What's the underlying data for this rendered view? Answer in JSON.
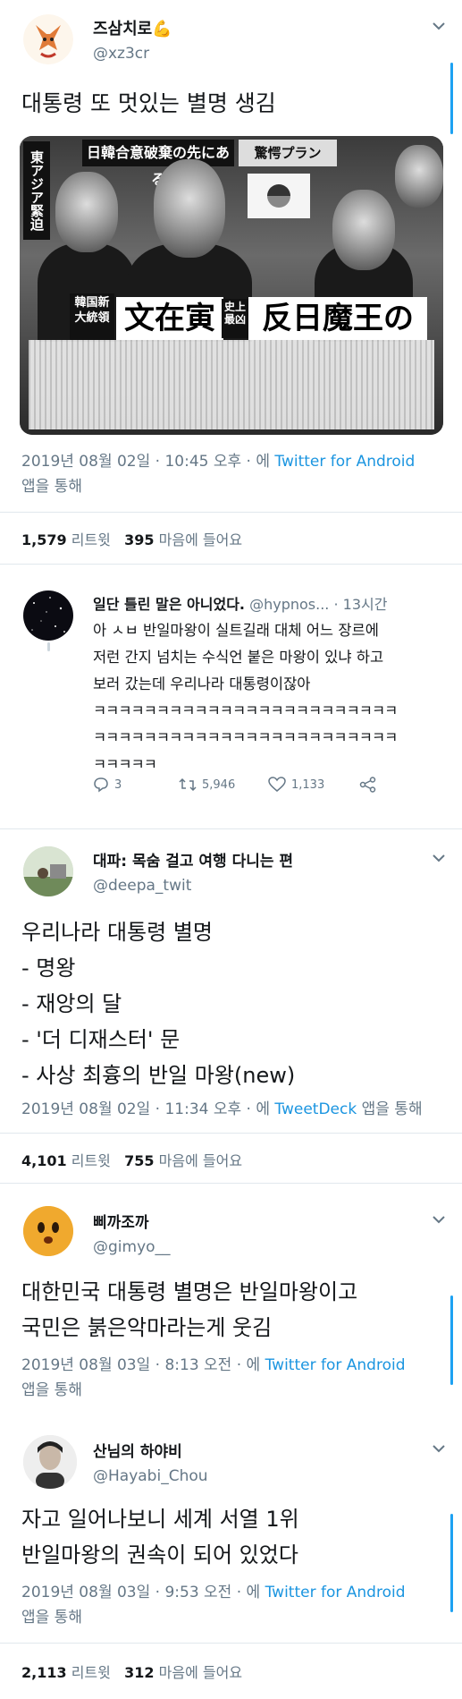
{
  "tweet1": {
    "name": "즈삼치로💪",
    "handle": "@xz3cr",
    "text": "대통령 또 멋있는 별명 생김",
    "photo": {
      "banner": "日韓合意破棄の先にある",
      "banner2": "驚愕プラン",
      "side": "東アジア緊迫",
      "korea_label": "韓国新大統領",
      "name_label": "文在寅",
      "hist_label": "史上最凶",
      "evil_label": "反日魔王の"
    },
    "meta_date": "2019년 08월 02일 · 10:45 오후 · 에 ",
    "meta_source": "Twitter for Android",
    "meta_suffix": "앱을 통해",
    "retweets": "1,579",
    "retweets_label": "리트윗",
    "likes": "395",
    "likes_label": "마음에 들어요"
  },
  "reply": {
    "name": "일단 틀린 말은 아니었다.",
    "handle": "@hypnos...",
    "time": "· 13시간",
    "lines": [
      "아 ㅅㅂ 반일마왕이 실트길래 대체 어느 장르에",
      "저런 간지 넘치는 수식언 붙은 마왕이 있냐 하고",
      "보러 갔는데 우리나라 대통령이잖아",
      "ㅋㅋㅋㅋㅋㅋㅋㅋㅋㅋㅋㅋㅋㅋㅋㅋㅋㅋㅋㅋㅋㅋㅋㅋ",
      "ㅋㅋㅋㅋㅋㅋㅋㅋㅋㅋㅋㅋㅋㅋㅋㅋㅋㅋㅋㅋㅋㅋㅋㅋ",
      "ㅋㅋㅋㅋㅋ"
    ],
    "replies": "3",
    "retweets": "5,946",
    "likes": "1,133"
  },
  "tweet2": {
    "name": "대파: 목숨 걸고 여행 다니는 편",
    "handle": "@deepa_twit",
    "lines": [
      "우리나라 대통령 별명",
      "- 명왕",
      "- 재앙의 달",
      "- '더 디재스터' 문",
      "- 사상 최흉의 반일 마왕(new)"
    ],
    "meta_date": "2019년 08월 02일 · 11:34 오후 · 에 ",
    "meta_source": "TweetDeck",
    "meta_suffix": " 앱을 통해",
    "retweets": "4,101",
    "retweets_label": "리트윗",
    "likes": "755",
    "likes_label": "마음에 들어요"
  },
  "tweet3": {
    "name": "삐까조까",
    "handle": "@gimyo__",
    "lines": [
      "대한민국 대통령 별명은 반일마왕이고",
      "국민은 붉은악마라는게 웃김"
    ],
    "meta_date": "2019년 08월 03일 · 8:13 오전 · 에 ",
    "meta_source": "Twitter for Android",
    "meta_suffix": "앱을 통해"
  },
  "tweet4": {
    "name": "산님의 하야비",
    "handle": "@Hayabi_Chou",
    "lines": [
      "자고 일어나보니 세계 서열 1위",
      "반일마왕의 권속이 되어 있었다"
    ],
    "meta_date": "2019년 08월 03일 · 9:53 오전 · 에 ",
    "meta_source": "Twitter for Android",
    "meta_suffix": "앱을 통해",
    "retweets": "2,113",
    "retweets_label": "리트윗",
    "likes": "312",
    "likes_label": "마음에 들어요"
  },
  "icons": {
    "chevron": "chevron-down-icon",
    "reply": "reply-icon",
    "retweet": "retweet-icon",
    "like": "heart-icon",
    "share": "share-icon"
  },
  "colors": {
    "link": "#1b95e0",
    "thread": "#1da1f2",
    "muted": "#657786"
  }
}
